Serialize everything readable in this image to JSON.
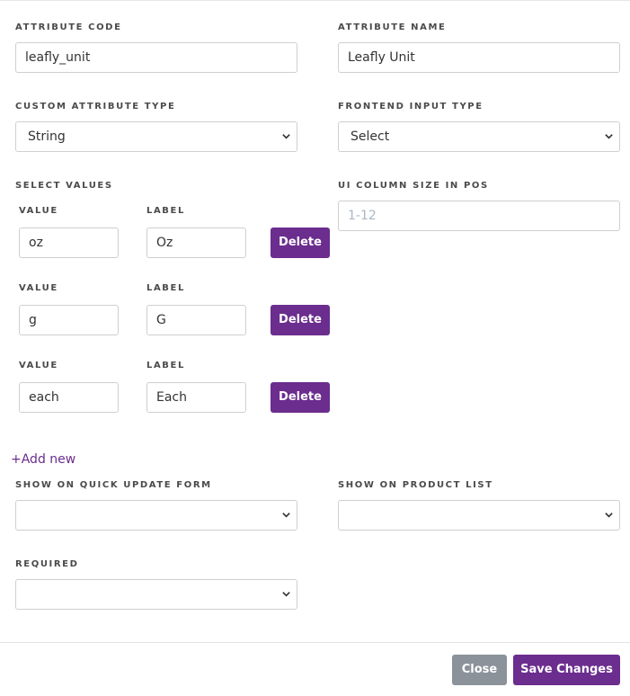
{
  "form": {
    "attribute_code": {
      "label": "ATTRIBUTE CODE",
      "value": "leafly_unit"
    },
    "attribute_name": {
      "label": "ATTRIBUTE NAME",
      "value": "Leafly Unit"
    },
    "custom_attribute_type": {
      "label": "CUSTOM ATTRIBUTE TYPE",
      "selected": "String"
    },
    "frontend_input_type": {
      "label": "FRONTEND INPUT TYPE",
      "selected": "Select"
    },
    "select_values": {
      "label": "SELECT VALUES",
      "value_header": "VALUE",
      "label_header": "LABEL",
      "delete_label": "Delete",
      "rows": [
        {
          "value": "oz",
          "label": "Oz"
        },
        {
          "value": "g",
          "label": "G"
        },
        {
          "value": "each",
          "label": "Each"
        }
      ]
    },
    "ui_column_size": {
      "label": "UI COLUMN SIZE IN POS",
      "placeholder": "1-12",
      "value": ""
    },
    "add_new_label": "+Add new",
    "show_on_quick_update": {
      "label": "SHOW ON QUICK UPDATE FORM",
      "selected": ""
    },
    "show_on_product_list": {
      "label": "SHOW ON PRODUCT LIST",
      "selected": ""
    },
    "required": {
      "label": "REQUIRED",
      "selected": ""
    }
  },
  "footer": {
    "close_label": "Close",
    "save_label": "Save Changes"
  },
  "colors": {
    "accent": "#6b2d8e",
    "close_button": "#8b9299",
    "border": "#cfcfcf",
    "placeholder": "#a9b7c6"
  },
  "icons": {
    "select_caret": "chevron-down-icon"
  }
}
